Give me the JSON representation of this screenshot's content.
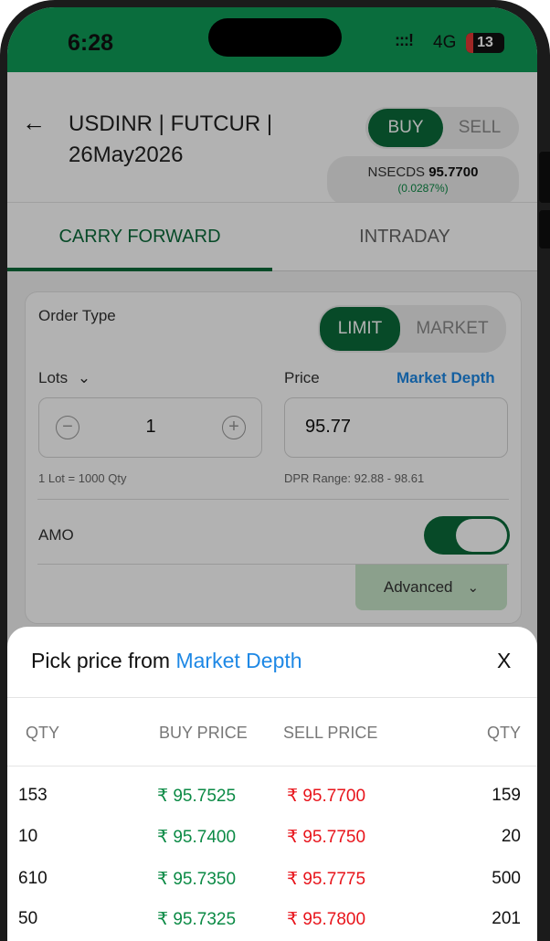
{
  "status_bar": {
    "time": "6:28",
    "signal": ":::!",
    "network": "4G",
    "battery": "13"
  },
  "header": {
    "title": "USDINR | FUTCUR | 26May2026",
    "buy_label": "BUY",
    "sell_label": "SELL",
    "exchange": "NSECDS",
    "price": "95.7700",
    "change": "(0.0287%)"
  },
  "tabs": [
    {
      "label": "CARRY FORWARD",
      "active": true
    },
    {
      "label": "INTRADAY",
      "active": false
    }
  ],
  "order": {
    "order_type_label": "Order Type",
    "limit_label": "LIMIT",
    "market_label": "MARKET",
    "lots_label": "Lots",
    "price_label": "Price",
    "market_depth_link": "Market Depth",
    "lots_value": "1",
    "price_value": "95.77",
    "lot_info": "1 Lot = 1000 Qty",
    "dpr_range": "DPR Range: 92.88 - 98.61",
    "amo_label": "AMO",
    "amo_enabled": true,
    "advanced_label": "Advanced"
  },
  "depth_sheet": {
    "title_prefix": "Pick price from",
    "title_link": "Market Depth",
    "close_label": "X",
    "columns": [
      "QTY",
      "BUY PRICE",
      "SELL PRICE",
      "QTY"
    ],
    "rows": [
      {
        "buy_qty": "153",
        "buy_price": "₹ 95.7525",
        "sell_price": "₹ 95.7700",
        "sell_qty": "159"
      },
      {
        "buy_qty": "10",
        "buy_price": "₹ 95.7400",
        "sell_price": "₹ 95.7750",
        "sell_qty": "20"
      },
      {
        "buy_qty": "610",
        "buy_price": "₹ 95.7350",
        "sell_price": "₹ 95.7775",
        "sell_qty": "500"
      },
      {
        "buy_qty": "50",
        "buy_price": "₹ 95.7325",
        "sell_price": "₹ 95.7800",
        "sell_qty": "201"
      }
    ]
  },
  "colors": {
    "brand_green": "#0b6b3a",
    "status_green": "#0f9d58",
    "buy_green": "#0b8a45",
    "sell_red": "#e8141b",
    "link_blue": "#1e88e5"
  }
}
